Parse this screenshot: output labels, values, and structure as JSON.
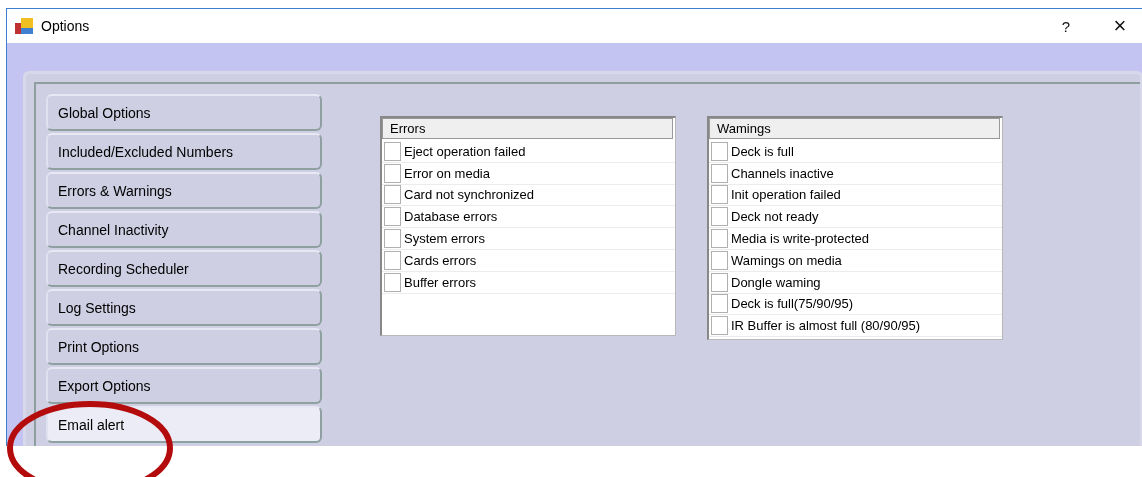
{
  "window": {
    "title": "Options",
    "help": "?",
    "close": "×"
  },
  "sidebar": {
    "items": [
      {
        "label": "Global Options",
        "selected": false,
        "circled": false
      },
      {
        "label": "Included/Excluded Numbers",
        "selected": false,
        "circled": false
      },
      {
        "label": "Errors & Warnings",
        "selected": false,
        "circled": false
      },
      {
        "label": "Channel Inactivity",
        "selected": false,
        "circled": false
      },
      {
        "label": "Recording Scheduler",
        "selected": false,
        "circled": false
      },
      {
        "label": "Log Settings",
        "selected": false,
        "circled": false
      },
      {
        "label": "Print Options",
        "selected": false,
        "circled": false
      },
      {
        "label": "Export Options",
        "selected": false,
        "circled": false
      },
      {
        "label": "Email alert",
        "selected": true,
        "circled": true
      }
    ]
  },
  "lists": [
    {
      "header": "Errors",
      "items": [
        {
          "label": "Eject operation failed",
          "checked": false
        },
        {
          "label": "Error on media",
          "checked": false
        },
        {
          "label": "Card not synchronized",
          "checked": false
        },
        {
          "label": "Database errors",
          "checked": false
        },
        {
          "label": "System errors",
          "checked": false
        },
        {
          "label": "Cards errors",
          "checked": false
        },
        {
          "label": "Buffer errors",
          "checked": false
        }
      ]
    },
    {
      "header": "Wamings",
      "items": [
        {
          "label": "Deck is full",
          "checked": false
        },
        {
          "label": "Channels inactive",
          "checked": false
        },
        {
          "label": "Init operation failed",
          "checked": false
        },
        {
          "label": "Deck not ready",
          "checked": false
        },
        {
          "label": "Media is write-protected",
          "checked": false
        },
        {
          "label": "Wamings on media",
          "checked": false
        },
        {
          "label": "Dongle waming",
          "checked": false
        },
        {
          "label": "Deck is full(75/90/95)",
          "checked": false
        },
        {
          "label": "IR Buffer is almost full (80/90/95)",
          "checked": false
        }
      ]
    }
  ]
}
